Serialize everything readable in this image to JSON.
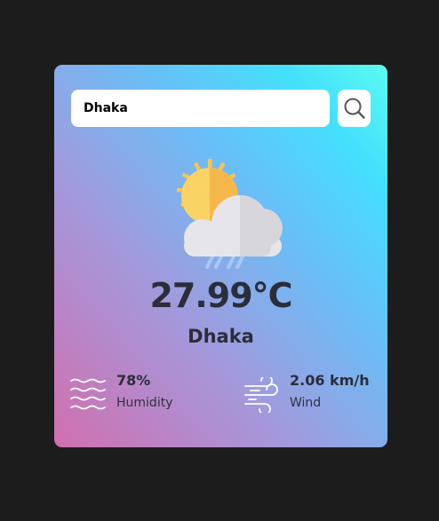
{
  "search": {
    "value": "Dhaka",
    "icon": "search-icon"
  },
  "weather": {
    "icon": "partly-cloudy-rain-icon",
    "temperature": "27.99°C",
    "city": "Dhaka"
  },
  "details": {
    "humidity": {
      "icon": "humidity-waves-icon",
      "value": "78%",
      "label": "Humidity"
    },
    "wind": {
      "icon": "wind-icon",
      "value": "2.06 km/h",
      "label": "Wind"
    }
  },
  "colors": {
    "page_background": "#1c1c1c",
    "gradient_bottom_left": "#d16fae",
    "gradient_top_right": "#5afaf0",
    "text": "#2b2d3a"
  }
}
